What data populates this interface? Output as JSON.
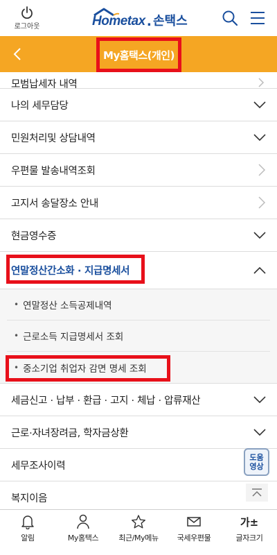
{
  "header": {
    "logout_label": "로그아웃",
    "logo_hometax": "Hometax",
    "logo_sep": ".",
    "logo_son": "손택스",
    "search_icon": "search-icon",
    "menu_icon": "hamburger-menu-icon"
  },
  "title_bar": {
    "title": "My홈택스(개인)",
    "color": "#f5a623"
  },
  "menu": {
    "partial_item": "모범납세자 내역",
    "items_top": [
      {
        "label": "나의 세무담당",
        "chevron": "down"
      },
      {
        "label": "민원처리및 상담내역",
        "chevron": "down"
      },
      {
        "label": "우편물 발송내역조회",
        "chevron": "right"
      },
      {
        "label": "고지서 송달장소 안내",
        "chevron": "right"
      },
      {
        "label": "현금영수증",
        "chevron": "down"
      }
    ],
    "active_item": {
      "label": "연말정산간소화 · 지급명세서",
      "chevron": "up"
    },
    "sub_items": [
      "연말정산 소득공제내역",
      "근로소득 지급명세서 조회",
      "중소기업 취업자 감면 명세 조회"
    ],
    "items_bottom": [
      {
        "label": "세금신고 · 납부 · 환급 · 고지 · 체납 · 압류재산",
        "chevron": "down"
      },
      {
        "label": "근로·자녀장려금, 학자금상환",
        "chevron": "down"
      },
      {
        "label": "세무조사이력",
        "chevron": ""
      },
      {
        "label": "복지이음",
        "chevron": ""
      }
    ]
  },
  "floating": {
    "help_line1": "도움",
    "help_line2": "영상"
  },
  "bottom_nav": [
    {
      "label": "알림",
      "icon": "bell-icon"
    },
    {
      "label": "My홈택스",
      "icon": "person-icon"
    },
    {
      "label": "최근/My메뉴",
      "icon": "star-icon"
    },
    {
      "label": "국세우편물",
      "icon": "envelope-icon"
    },
    {
      "label": "글자크기",
      "icon": "font-size-icon",
      "glyph": "가±"
    }
  ]
}
